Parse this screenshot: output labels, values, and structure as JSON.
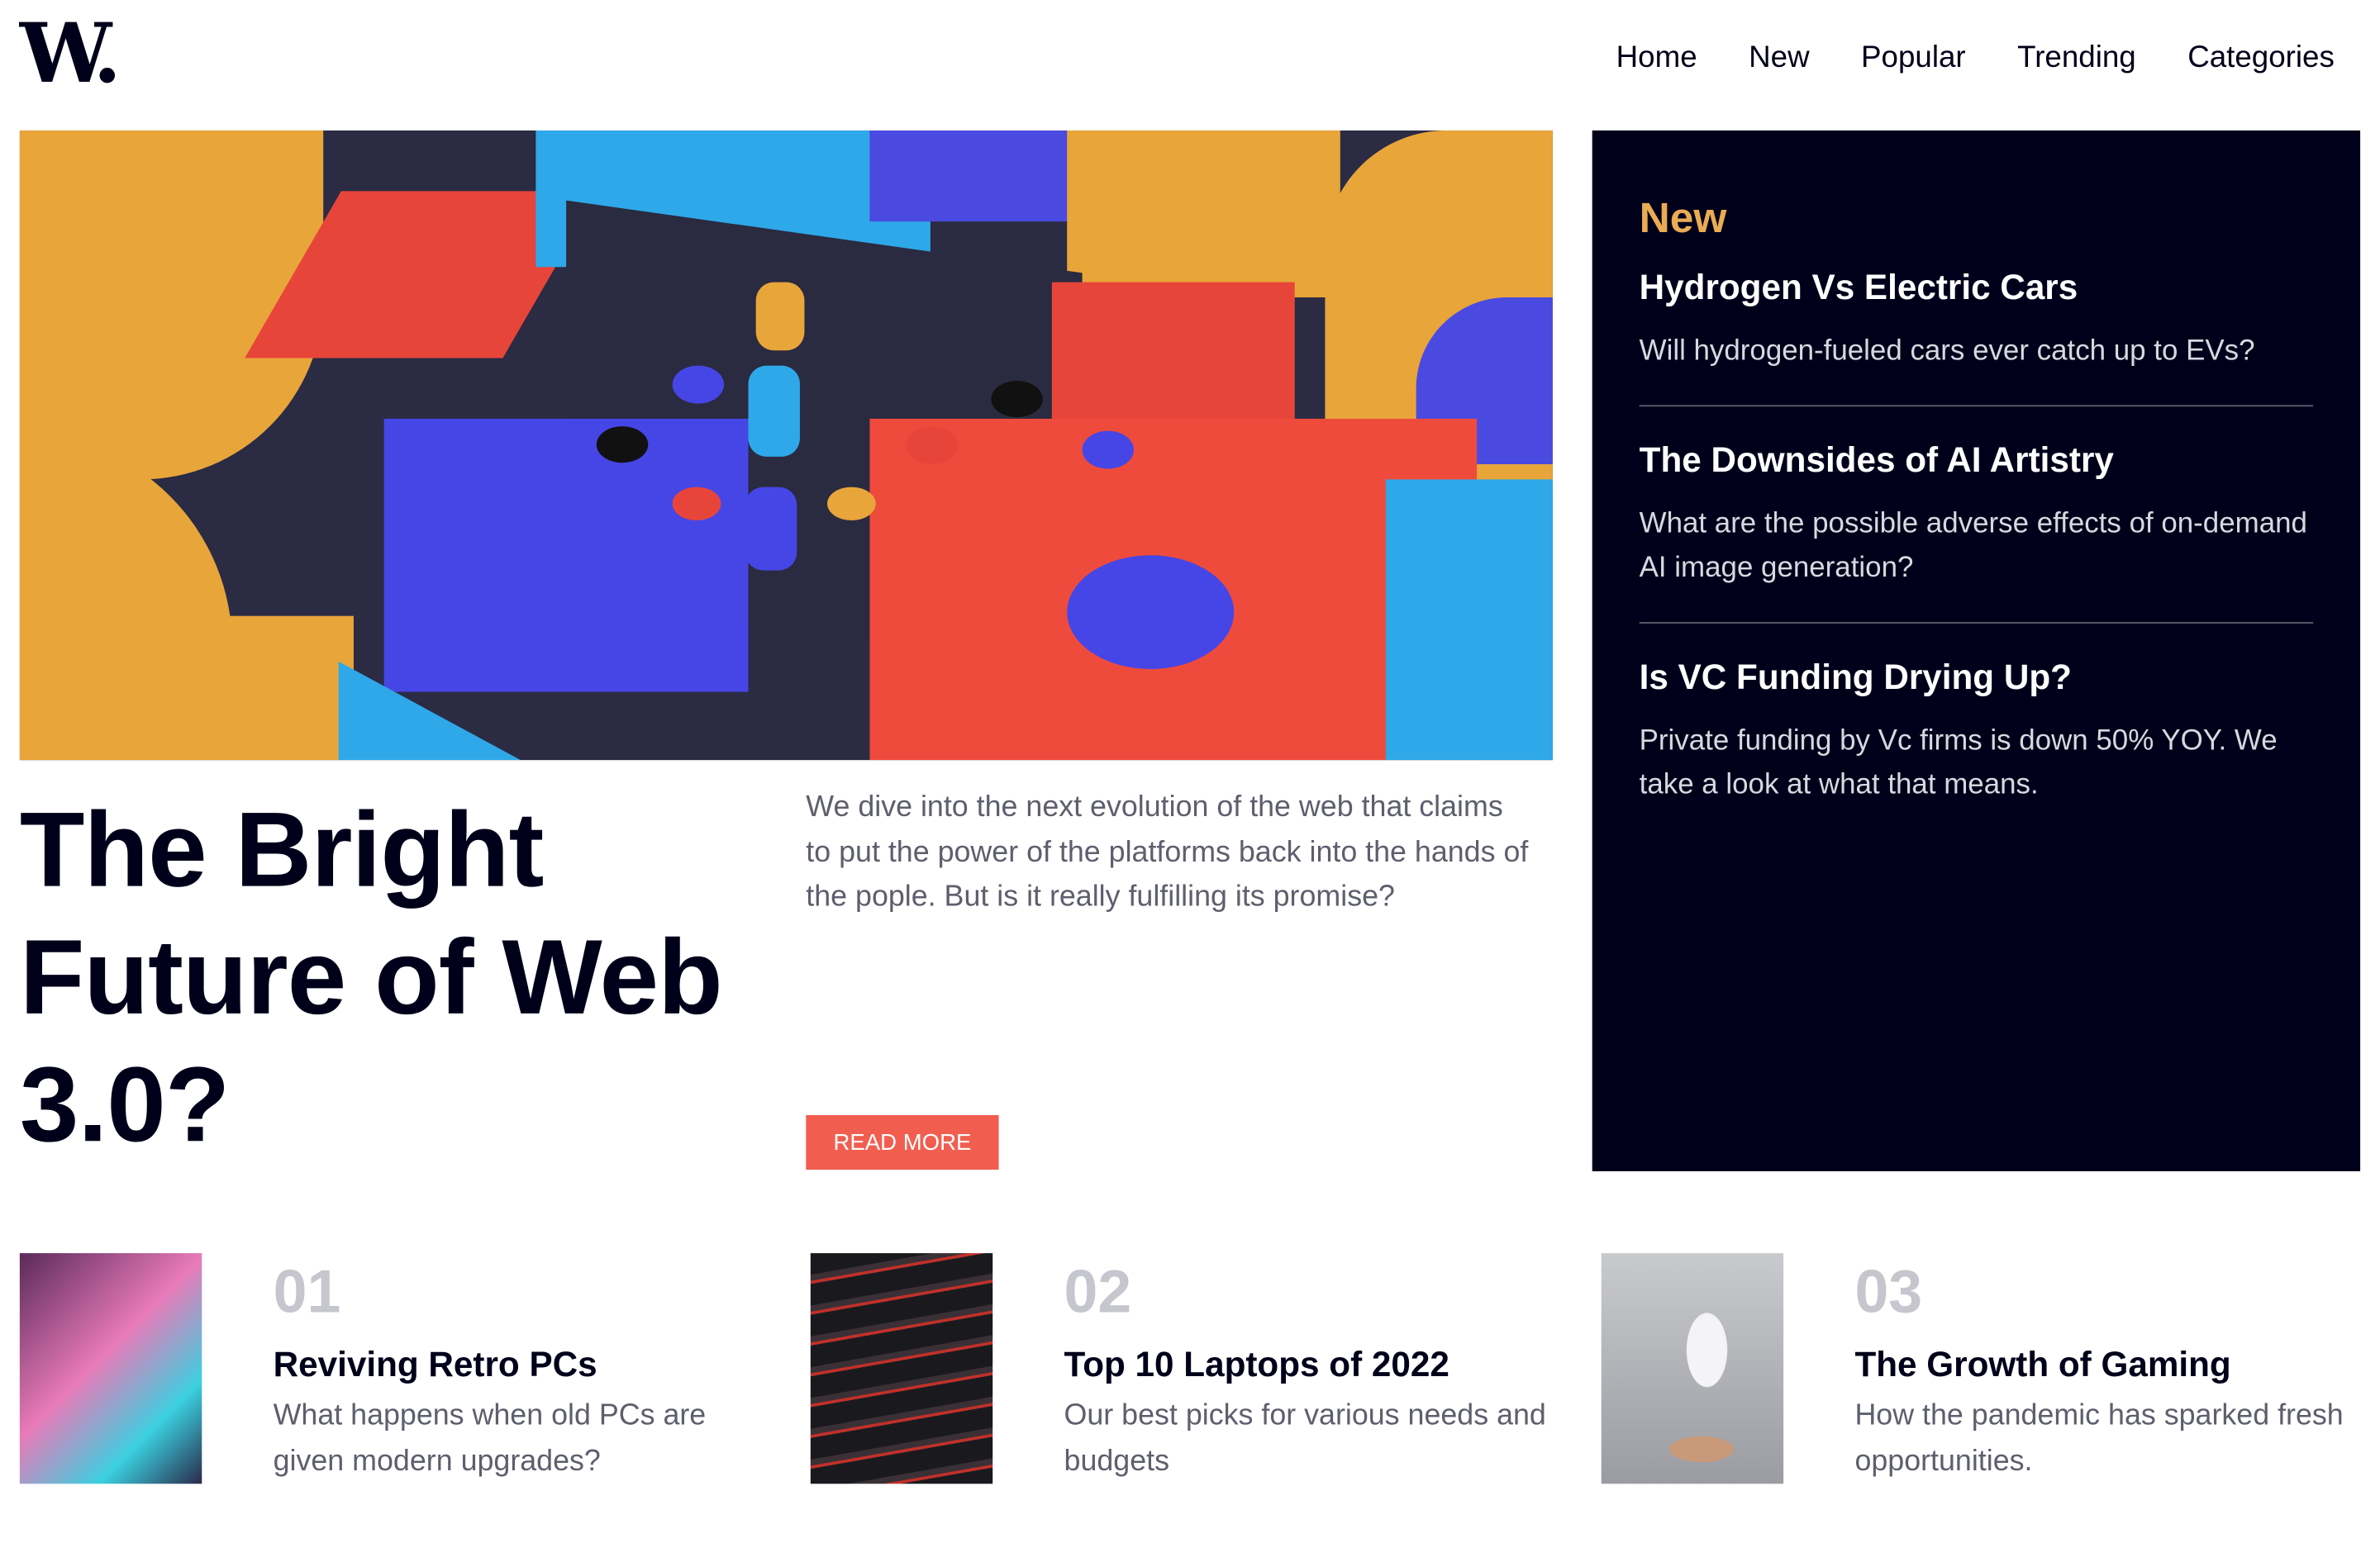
{
  "header": {
    "logo": "W.",
    "nav": [
      "Home",
      "New",
      "Popular",
      "Trending",
      "Categories"
    ]
  },
  "hero": {
    "title": "The Bright Future of Web 3.0?",
    "description": "We dive into the next evolution of the web that claims to put the power of the platforms back into the hands of the pople. But is it really fulfilling its promise?",
    "button": "READ MORE"
  },
  "sidebar": {
    "heading": "New",
    "items": [
      {
        "title": "Hydrogen Vs Electric Cars",
        "text": "Will hydrogen-fueled cars ever catch up to EVs?"
      },
      {
        "title": "The Downsides of AI Artistry",
        "text": "What are the possible adverse effects of on-demand AI image generation?"
      },
      {
        "title": "Is VC Funding Drying Up?",
        "text": "Private funding by Vc firms is down 50% YOY. We take a look at what that means."
      }
    ]
  },
  "cards": [
    {
      "num": "01",
      "title": "Reviving Retro PCs",
      "text": "What happens when old PCs are given modern upgrades?"
    },
    {
      "num": "02",
      "title": "Top 10 Laptops of 2022",
      "text": "Our best picks for various needs and budgets"
    },
    {
      "num": "03",
      "title": "The Growth of Gaming",
      "text": "How the pandemic has sparked fresh opportunities."
    }
  ],
  "colors": {
    "accent": "#f15e50",
    "dark": "#00001a",
    "sidebar_heading": "#e9ab53"
  }
}
